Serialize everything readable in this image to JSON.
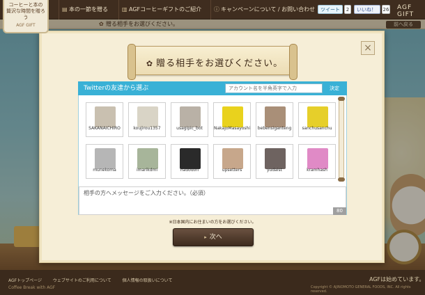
{
  "header": {
    "logo_line1": "コーヒーと本の",
    "logo_line2": "贅沢な時間を贈ろう",
    "logo_line3": "AGF GIFT",
    "nav": [
      {
        "label": "本の一節を贈る"
      },
      {
        "label": "AGFコーヒーギフトのご紹介"
      },
      {
        "label": "キャンペーンについて / お問い合わせ"
      }
    ],
    "tweet_label": "ツイート",
    "tweet_count": "2",
    "like_label": "いいね！",
    "like_count": "26",
    "brand": "AGF GIFT"
  },
  "breadcrumb": {
    "label": "贈る相手をお選びください。",
    "back_label": "前へ戻る"
  },
  "modal": {
    "title": "贈る相手をお選びください。",
    "panel_title": "Twitterの友達から選ぶ",
    "account_placeholder": "アカウント名を半角英字で入力",
    "search_label": "決定",
    "friends": [
      {
        "name": "SAKANAICHIRO",
        "avatar_color": "#c9c0b0"
      },
      {
        "name": "koujirou1357",
        "avatar_color": "#d9d4c6"
      },
      {
        "name": "usagipic_bot",
        "avatar_color": "#b9b1a6"
      },
      {
        "name": "NakajoMasayoshi",
        "avatar_color": "#e9d21d"
      },
      {
        "name": "bebensiganteng",
        "avatar_color": "#a98f78"
      },
      {
        "name": "sanchusanchu",
        "avatar_color": "#e6cf2a"
      },
      {
        "name": "munekoma",
        "avatar_color": "#b6b6b6"
      },
      {
        "name": "imarikdmi",
        "avatar_color": "#a7b59a"
      },
      {
        "name": "hadodon",
        "avatar_color": "#2a2a2a"
      },
      {
        "name": "upsetters",
        "avatar_color": "#c7a78b"
      },
      {
        "name": "yudaist",
        "avatar_color": "#6e6360"
      },
      {
        "name": "kramhash",
        "avatar_color": "#e08ac6"
      }
    ],
    "message_placeholder": "相手の方へメッセージをご入力ください。（必須）",
    "char_count": "80",
    "note": "※日本国内にお住まいの方をお選びください。",
    "next_label": "次へ",
    "close_label": "×"
  },
  "footer": {
    "links": [
      "AGFトップページ",
      "ウェブサイトのご利用について",
      "個人情報の取扱いについて"
    ],
    "brand_line": "Coffee Break with AGF",
    "agf_text": "AGFは始めています。",
    "copyright": "Copyright © AJINOMOTO GENERAL FOODS, INC. All rights reserved."
  }
}
